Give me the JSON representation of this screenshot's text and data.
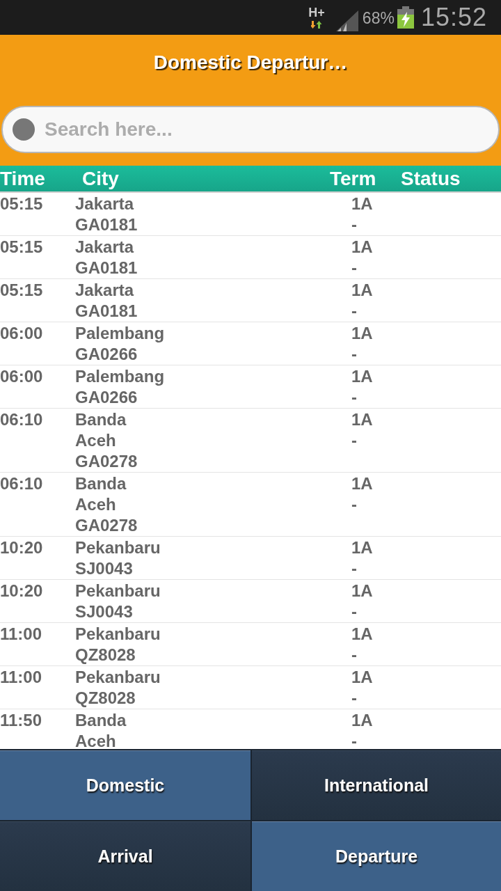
{
  "status_bar": {
    "network": "H+",
    "battery": "68%",
    "time": "15:52"
  },
  "header": {
    "title": "Domestic Departur…",
    "search": {
      "placeholder": "Search here..."
    }
  },
  "table": {
    "columns": [
      "Time",
      "City",
      "Term",
      "Status"
    ],
    "rows": [
      {
        "time": "05:15",
        "city": "Jakarta",
        "flight": "GA0181",
        "term": "1A",
        "term_line_2": "-"
      },
      {
        "time": "05:15",
        "city": "Jakarta",
        "flight": "GA0181",
        "term": "1A",
        "term_line_2": "-"
      },
      {
        "time": "05:15",
        "city": "Jakarta",
        "flight": "GA0181",
        "term": "1A",
        "term_line_2": "-"
      },
      {
        "time": "06:00",
        "city": "Palembang",
        "flight": "GA0266",
        "term": "1A",
        "term_line_2": "-"
      },
      {
        "time": "06:00",
        "city": "Palembang",
        "flight": "GA0266",
        "term": "1A",
        "term_line_2": "-"
      },
      {
        "time": "06:10",
        "city": "Banda Aceh",
        "flight": "GA0278",
        "term": "1A",
        "term_line_2": "-"
      },
      {
        "time": "06:10",
        "city": "Banda Aceh",
        "flight": "GA0278",
        "term": "1A",
        "term_line_2": "-"
      },
      {
        "time": "10:20",
        "city": "Pekanbaru",
        "flight": "SJ0043",
        "term": "1A",
        "term_line_2": "-"
      },
      {
        "time": "10:20",
        "city": "Pekanbaru",
        "flight": "SJ0043",
        "term": "1A",
        "term_line_2": "-"
      },
      {
        "time": "11:00",
        "city": "Pekanbaru",
        "flight": "QZ8028",
        "term": "1A",
        "term_line_2": "-"
      },
      {
        "time": "11:00",
        "city": "Pekanbaru",
        "flight": "QZ8028",
        "term": "1A",
        "term_line_2": "-"
      },
      {
        "time": "11:50",
        "city": "Banda Aceh",
        "term": "1A",
        "term_line_2": "-"
      }
    ]
  },
  "bottom_tabs": {
    "region": [
      {
        "label": "Domestic",
        "selected": true
      },
      {
        "label": "International",
        "selected": false
      }
    ],
    "direction": [
      {
        "label": "Arrival",
        "selected": false
      },
      {
        "label": "Departure",
        "selected": true
      }
    ]
  }
}
